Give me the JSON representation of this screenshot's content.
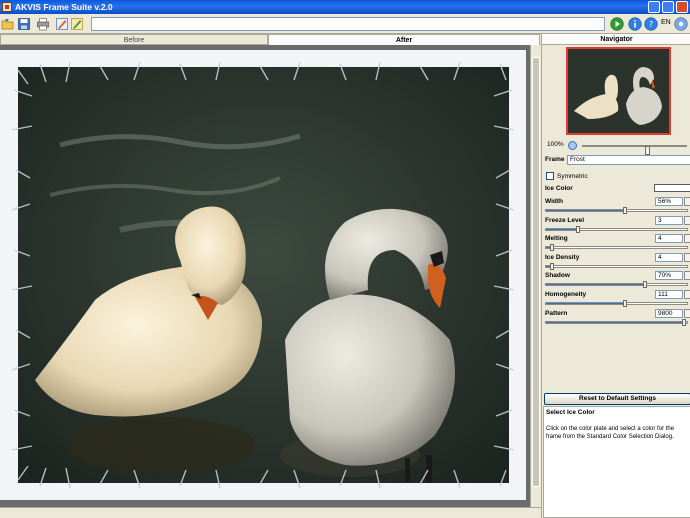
{
  "window": {
    "title": "AKVIS Frame Suite v.2.0"
  },
  "toolbar": {
    "language": "EN",
    "url_value": ""
  },
  "tabs": [
    {
      "label": "Before"
    },
    {
      "label": "After"
    }
  ],
  "navigator": {
    "title": "Navigator",
    "zoom": "100%",
    "zoom_fraction": 0.62
  },
  "settings": {
    "frame": {
      "label": "Frame",
      "value": "Frost"
    },
    "symmetric": {
      "label": "Symmetric",
      "checked": false
    },
    "ice_color": {
      "label": "Ice Color",
      "color": "#ffffff"
    },
    "params": [
      {
        "label": "Width",
        "value": "56%",
        "fraction": 0.56
      },
      {
        "label": "Freeze Level",
        "value": "3",
        "fraction": 0.23
      },
      {
        "label": "Melting",
        "value": "4",
        "fraction": 0.04
      },
      {
        "label": "Ice Density",
        "value": "4",
        "fraction": 0.04
      },
      {
        "label": "Shadow",
        "value": "70%",
        "fraction": 0.7
      },
      {
        "label": "Homogeneity",
        "value": "111",
        "fraction": 0.56
      },
      {
        "label": "Pattern",
        "value": "9800",
        "fraction": 0.98
      }
    ]
  },
  "reset_button": {
    "label": "Reset to Default Settings"
  },
  "help": {
    "title": "Select Ice Color",
    "text": "Click on the color plate and select a color for the frame from the Standard Color Selection Dialog."
  }
}
